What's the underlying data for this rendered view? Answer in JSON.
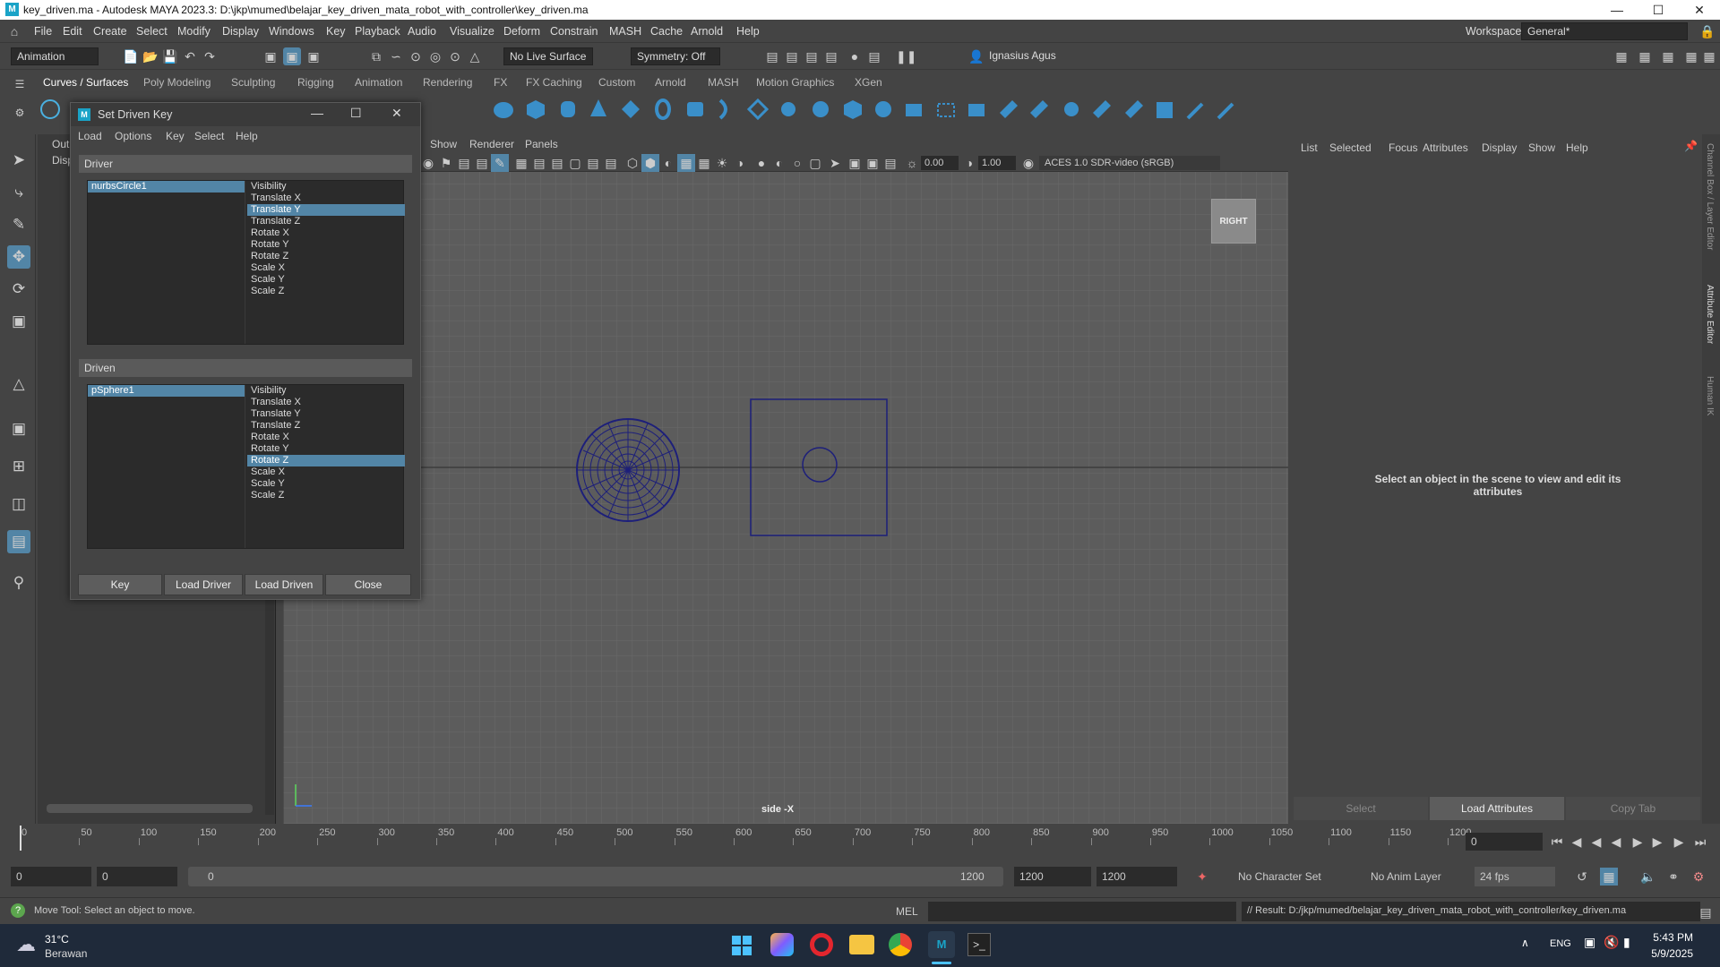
{
  "window": {
    "title": "key_driven.ma - Autodesk MAYA 2023.3: D:\\jkp\\mumed\\belajar_key_driven_mata_robot_with_controller\\key_driven.ma"
  },
  "menubar": {
    "items": [
      "File",
      "Edit",
      "Create",
      "Select",
      "Modify",
      "Display",
      "Windows",
      "Key",
      "Playback",
      "Audio",
      "Visualize",
      "Deform",
      "Constrain",
      "MASH",
      "Cache",
      "Arnold",
      "Help"
    ],
    "workspace_label": "Workspace:",
    "workspace_value": "General*"
  },
  "statusline": {
    "menuset": "Animation",
    "live_surface": "No Live Surface",
    "symmetry": "Symmetry: Off",
    "user": "Ignasius Agus"
  },
  "shelf": {
    "tabs": [
      "Curves / Surfaces",
      "Poly Modeling",
      "Sculpting",
      "Rigging",
      "Animation",
      "Rendering",
      "FX",
      "FX Caching",
      "Custom",
      "Arnold",
      "MASH",
      "Motion Graphics",
      "XGen"
    ],
    "active_tab": "Curves / Surfaces"
  },
  "outliner": {
    "menu_partial": "Out",
    "menu_partial2": "Disp"
  },
  "viewport": {
    "menu": [
      "Show",
      "Renderer",
      "Panels"
    ],
    "exposure": "0.00",
    "gamma": "1.00",
    "color_space": "ACES 1.0 SDR-video (sRGB)",
    "view_cube_label": "RIGHT",
    "camera_label": "side -X"
  },
  "attribute_editor": {
    "menu": [
      "List",
      "Selected",
      "Focus",
      "Attributes",
      "Display",
      "Show",
      "Help"
    ],
    "message": "Select an object in the scene to view and edit its attributes",
    "buttons": [
      "Select",
      "Load Attributes",
      "Copy Tab"
    ]
  },
  "right_strip": {
    "tabs": [
      "Channel Box / Layer Editor",
      "Attribute Editor",
      "Human IK"
    ]
  },
  "dialog": {
    "title": "Set Driven Key",
    "menu": [
      "Load",
      "Options",
      "Key",
      "Select",
      "Help"
    ],
    "driver": {
      "header": "Driver",
      "object": "nurbsCircle1",
      "attributes": [
        "Visibility",
        "Translate X",
        "Translate Y",
        "Translate Z",
        "Rotate X",
        "Rotate Y",
        "Rotate Z",
        "Scale X",
        "Scale Y",
        "Scale Z"
      ],
      "selected_attribute": "Translate Y"
    },
    "driven": {
      "header": "Driven",
      "object": "pSphere1",
      "attributes": [
        "Visibility",
        "Translate X",
        "Translate Y",
        "Translate Z",
        "Rotate X",
        "Rotate Y",
        "Rotate Z",
        "Scale X",
        "Scale Y",
        "Scale Z"
      ],
      "selected_attribute": "Rotate Z"
    },
    "buttons": {
      "key": "Key",
      "load_driver": "Load Driver",
      "load_driven": "Load Driven",
      "close": "Close"
    }
  },
  "timeline": {
    "ticks": [
      "0",
      "50",
      "100",
      "150",
      "200",
      "250",
      "300",
      "350",
      "400",
      "450",
      "500",
      "550",
      "600",
      "650",
      "700",
      "750",
      "800",
      "850",
      "900",
      "950",
      "1000",
      "1050",
      "1100",
      "1150",
      "1200"
    ],
    "current_frame": "0"
  },
  "range": {
    "start": "0",
    "playback_start": "0",
    "slider_start": "0",
    "slider_end": "1200",
    "playback_end": "1200",
    "end": "1200",
    "character_set": "No Character Set",
    "anim_layer": "No Anim Layer",
    "fps": "24 fps"
  },
  "commandline": {
    "help": "Move Tool: Select an object to move.",
    "lang": "MEL",
    "result": "// Result: D:/jkp/mumed/belajar_key_driven_mata_robot_with_controller/key_driven.ma"
  },
  "taskbar": {
    "weather_temp": "31°C",
    "weather_desc": "Berawan",
    "lang": "ENG",
    "time": "5:43 PM",
    "date": "5/9/2025"
  }
}
